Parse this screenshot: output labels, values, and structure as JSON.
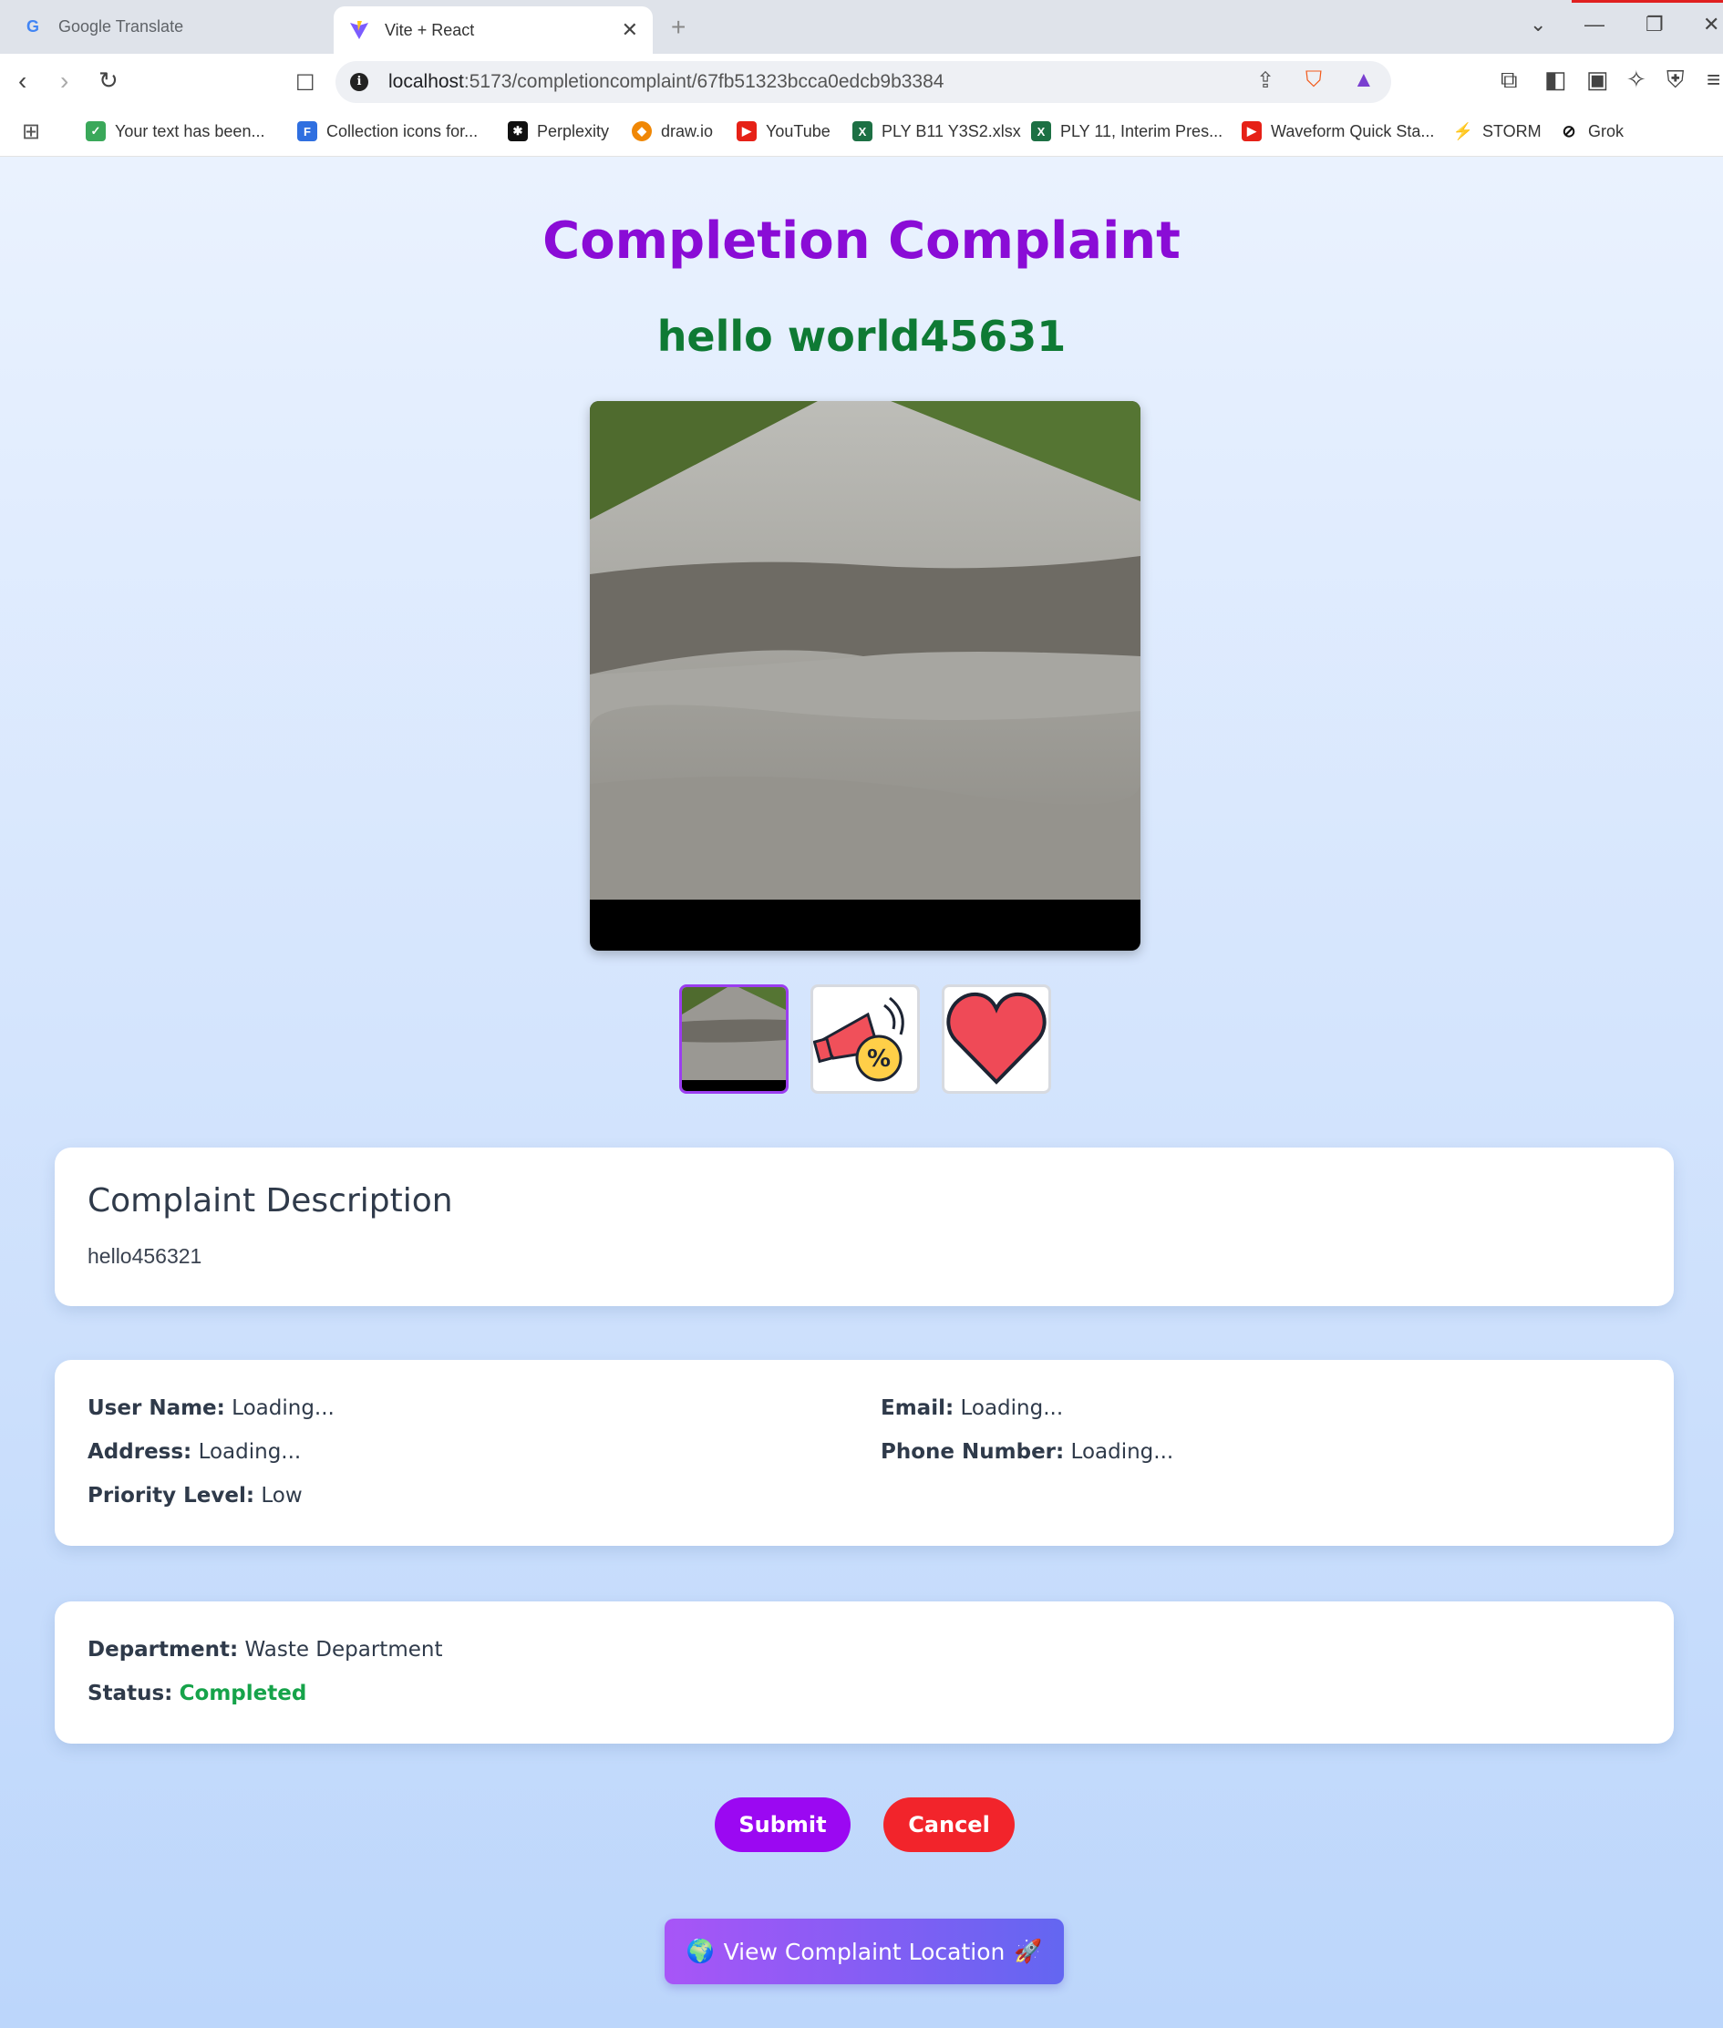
{
  "browser": {
    "tabs": [
      {
        "title": "Google Translate",
        "icon": "google-translate-icon"
      },
      {
        "title": "Vite + React",
        "icon": "vite-icon"
      }
    ],
    "url_host": "localhost",
    "url_path": ":5173/completioncomplaint/67fb51323bcca0edcb9b3384",
    "bookmarks": [
      {
        "label": "Your text has been...",
        "icon": "check-icon"
      },
      {
        "label": "Collection icons for...",
        "icon": "flaticon-icon"
      },
      {
        "label": "Perplexity",
        "icon": "perplexity-icon"
      },
      {
        "label": "draw.io",
        "icon": "drawio-icon"
      },
      {
        "label": "YouTube",
        "icon": "youtube-icon"
      },
      {
        "label": "PLY B11 Y3S2.xlsx",
        "icon": "excel-icon"
      },
      {
        "label": "PLY 11, Interim Pres...",
        "icon": "excel-icon"
      },
      {
        "label": "Waveform Quick Sta...",
        "icon": "youtube-icon"
      },
      {
        "label": "STORM",
        "icon": "bolt-icon"
      },
      {
        "label": "Grok",
        "icon": "grok-icon"
      }
    ]
  },
  "page": {
    "title": "Completion Complaint",
    "complaint_title": "hello world45631",
    "description_heading": "Complaint Description",
    "description": "hello456321",
    "user": {
      "name_label": "User Name:",
      "name": "Loading...",
      "email_label": "Email:",
      "email": "Loading...",
      "address_label": "Address:",
      "address": "Loading...",
      "phone_label": "Phone Number:",
      "phone": "Loading...",
      "priority_label": "Priority Level:",
      "priority": "Low"
    },
    "department_label": "Department:",
    "department": "Waste Department",
    "status_label": "Status:",
    "status": "Completed",
    "submit_label": "Submit",
    "cancel_label": "Cancel",
    "location_button_label": "View Complaint Location",
    "thumbnails": [
      "road-photo",
      "megaphone-discount-icon",
      "heart-icon"
    ]
  },
  "colors": {
    "title": "#8a0cd6",
    "subtitle": "#0e7a34",
    "status": "#16a34a",
    "submit": "#9b08f2",
    "cancel": "#f2242b"
  }
}
